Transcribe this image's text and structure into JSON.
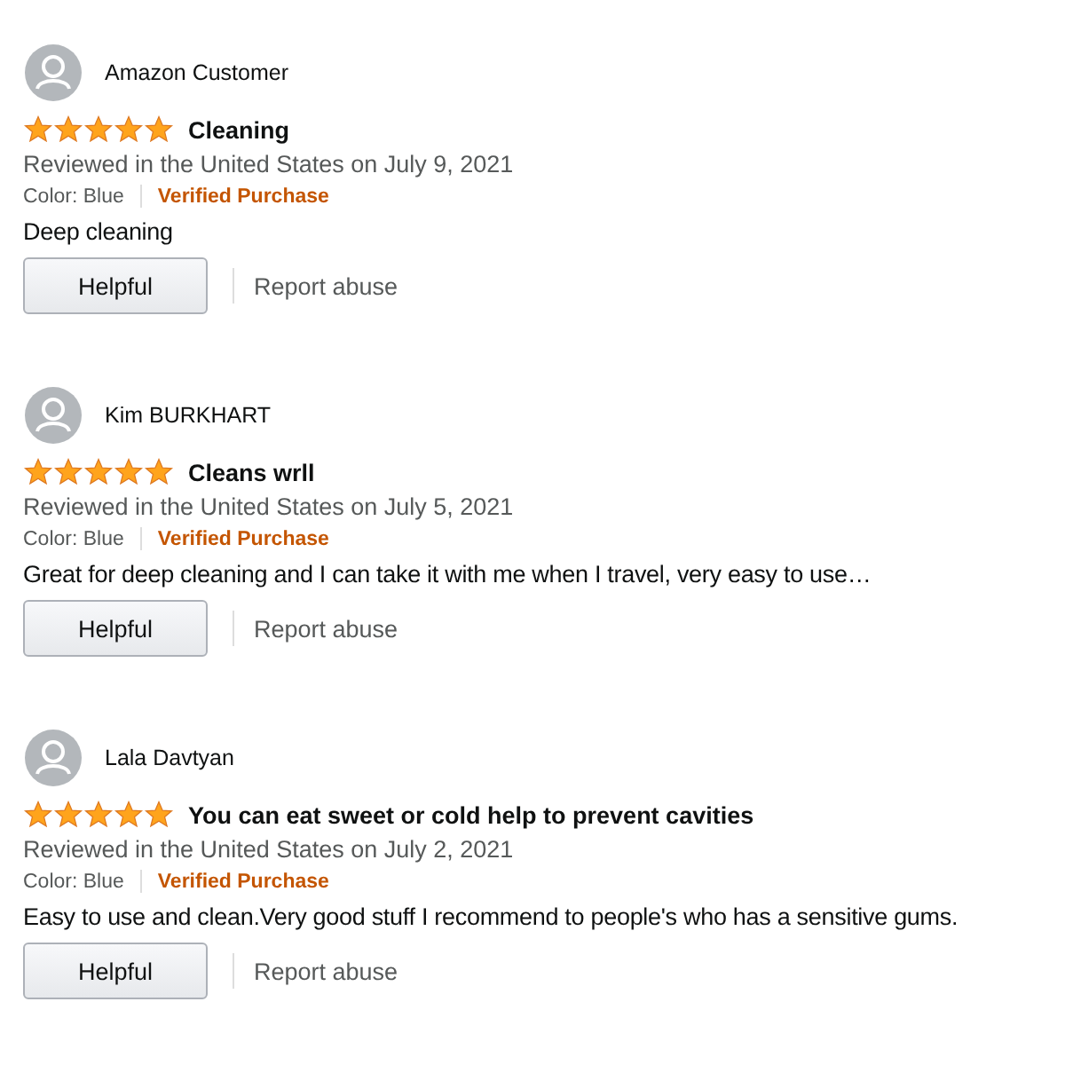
{
  "reviews": [
    {
      "author": "Amazon Customer",
      "stars": 5,
      "title": "Cleaning",
      "date": "Reviewed in the United States on July 9, 2021",
      "variant": "Color: Blue",
      "badge": "Verified Purchase",
      "body": "Deep cleaning",
      "helpful": "Helpful",
      "report": "Report abuse"
    },
    {
      "author": "Kim BURKHART",
      "stars": 5,
      "title": "Cleans wrll",
      "date": "Reviewed in the United States on July 5, 2021",
      "variant": "Color: Blue",
      "badge": "Verified Purchase",
      "body": "Great for deep cleaning and I can take it with me when I travel, very easy to use…",
      "helpful": "Helpful",
      "report": "Report abuse"
    },
    {
      "author": "Lala Davtyan",
      "stars": 5,
      "title": "You can eat sweet or cold help to prevent cavities",
      "date": "Reviewed in the United States on July 2, 2021",
      "variant": "Color: Blue",
      "badge": "Verified Purchase",
      "body": "Easy to use and clean.Very good stuff I recommend to people's who has a sensitive gums.",
      "helpful": "Helpful",
      "report": "Report abuse"
    }
  ]
}
